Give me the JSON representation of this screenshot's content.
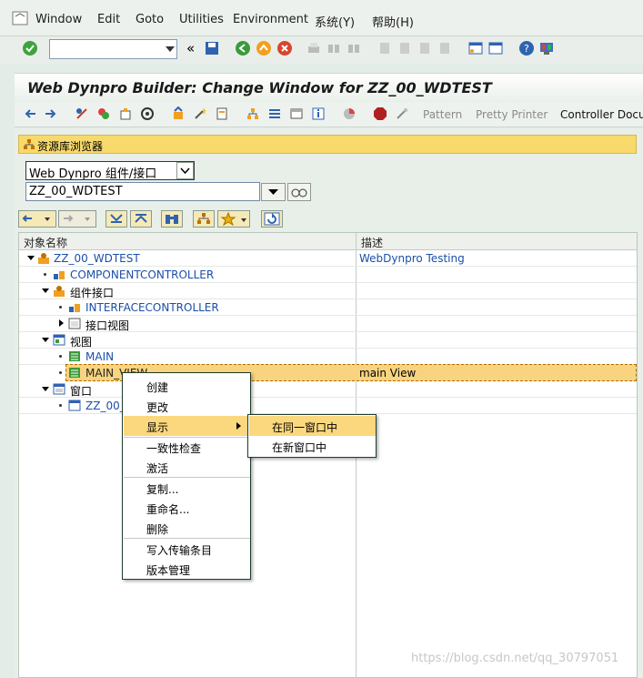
{
  "menubar": {
    "items": [
      "Window",
      "Edit",
      "Goto",
      "Utilities",
      "Environment",
      "系统(Y)",
      "帮助(H)"
    ]
  },
  "title": "Web Dynpro Builder: Change Window for ZZ_00_WDTEST",
  "app_toolbar": {
    "pattern": "Pattern",
    "pretty_printer": "Pretty Printer",
    "controller_doc": "Controller Docum"
  },
  "repository": {
    "header": "资源库浏览器",
    "object_type": "Web Dynpro 组件/接口",
    "object_name": "ZZ_00_WDTEST"
  },
  "tree": {
    "columns": [
      "对象名称",
      "描述"
    ],
    "rows": [
      {
        "label": "ZZ_00_WDTEST",
        "desc": "WebDynpro Testing"
      },
      {
        "label": "COMPONENTCONTROLLER",
        "desc": ""
      },
      {
        "label": "组件接口",
        "desc": ""
      },
      {
        "label": "INTERFACECONTROLLER",
        "desc": ""
      },
      {
        "label": "接口视图",
        "desc": ""
      },
      {
        "label": "视图",
        "desc": ""
      },
      {
        "label": "MAIN",
        "desc": ""
      },
      {
        "label": "MAIN_VIEW",
        "desc": "main View"
      },
      {
        "label": "窗口",
        "desc": ""
      },
      {
        "label": "ZZ_00_",
        "desc": ""
      }
    ]
  },
  "context_menu": {
    "items": [
      "创建",
      "更改",
      "显示",
      "一致性检查",
      "激活",
      "复制...",
      "重命名...",
      "删除",
      "写入传输条目",
      "版本管理"
    ],
    "highlighted": "显示"
  },
  "submenu": {
    "items": [
      "在同一窗口中",
      "在新窗口中"
    ],
    "highlighted": "在同一窗口中"
  },
  "watermark": "https://blog.csdn.net/qq_30797051"
}
